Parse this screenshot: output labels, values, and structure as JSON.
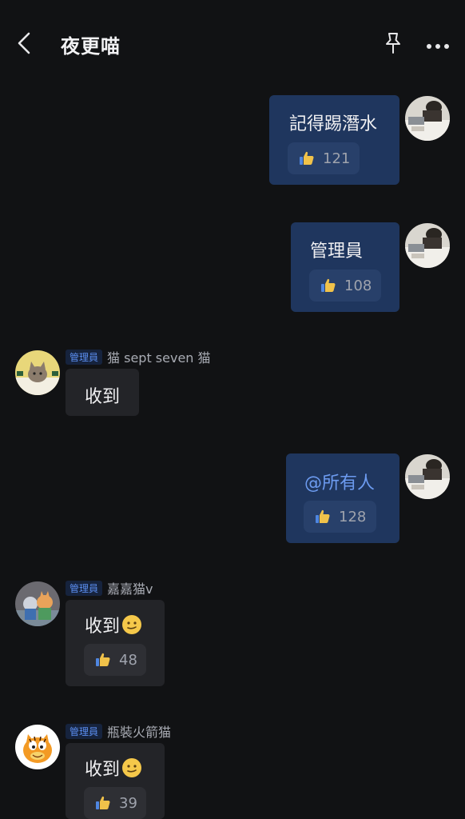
{
  "header": {
    "title": "夜更喵"
  },
  "messages": [
    {
      "text": "記得踢潛水",
      "likes": "121"
    },
    {
      "text": "管理員",
      "likes": "108"
    },
    {
      "badge": "管理員",
      "sender": "猫 sept seven 猫",
      "text": "收到"
    },
    {
      "text": "@所有人",
      "likes": "128"
    },
    {
      "badge": "管理員",
      "sender": "嘉嘉猫v",
      "text": "收到",
      "likes": "48"
    },
    {
      "badge": "管理員",
      "sender": "瓶裝火箭猫",
      "text": "收到",
      "likes": "39"
    }
  ],
  "colors": {
    "outgoing_bubble": "#1f365e",
    "incoming_bubble": "#232428",
    "mention": "#6c9bf0",
    "admin_badge": "#5b8ef0"
  },
  "icons": {
    "back": "chevron-left-icon",
    "pin": "pin-icon",
    "more": "more-dots-icon",
    "like": "thumbs-up-icon",
    "emoji": "slightly-smiling-face-icon"
  }
}
